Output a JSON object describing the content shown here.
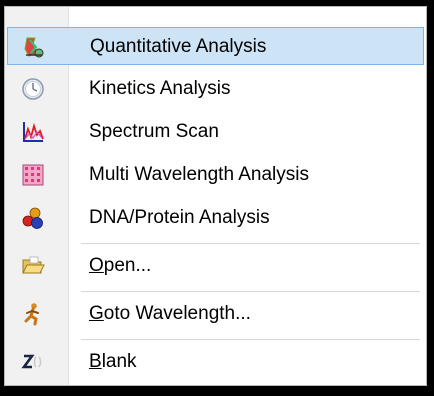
{
  "menu": {
    "items": [
      {
        "label": "Quantitative Analysis",
        "icon": "quantitative-analysis-icon",
        "highlighted": true
      },
      {
        "label": "Kinetics Analysis",
        "icon": "kinetics-clock-icon"
      },
      {
        "label": "Spectrum Scan",
        "icon": "spectrum-graph-icon"
      },
      {
        "label": "Multi Wavelength Analysis",
        "icon": "multi-wavelength-grid-icon"
      },
      {
        "label": "DNA/Protein Analysis",
        "icon": "dna-protein-molecule-icon"
      },
      {
        "accel": "O",
        "rest": "pen...",
        "icon": "open-folder-icon"
      },
      {
        "accel": "G",
        "rest": "oto Wavelength...",
        "icon": "goto-wavelength-runner-icon"
      },
      {
        "accel": "B",
        "rest": "lank",
        "icon": "blank-zero-icon"
      }
    ]
  },
  "colors": {
    "highlight_bg": "#cde4f7",
    "highlight_border": "#7eb4ea",
    "gutter": "#f1f1f1"
  }
}
